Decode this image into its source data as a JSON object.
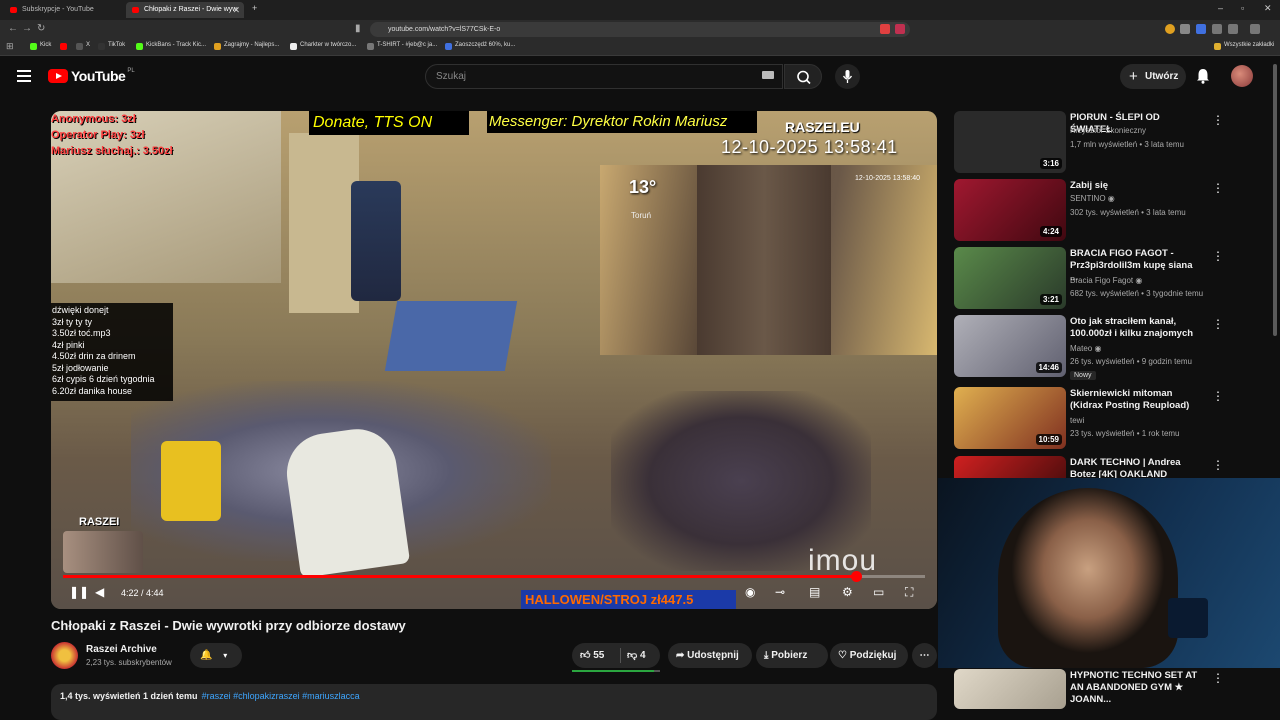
{
  "browser": {
    "tabs": [
      {
        "label": "Subskrypcje - YouTube",
        "active": false
      },
      {
        "label": "Chłopaki z Raszei - Dwie wyw",
        "active": true
      }
    ],
    "url": "youtube.com/watch?v=lS77CSk-E-o",
    "bookmarks": [
      "Kick",
      "X",
      "TikTok",
      "KickBans - Track Kic...",
      "Zagrajmy - Najleps...",
      "Charkter w twórczo...",
      "T-SHIRT - #jeb@c ja...",
      "Zaoszczędź 60%, ku..."
    ],
    "bookmarks_right": "Wszystkie zakładki"
  },
  "header": {
    "logo_text": "YouTube",
    "logo_country": "PL",
    "search_placeholder": "Szukaj",
    "create_label": "Utwórz"
  },
  "video": {
    "overlay_donations": [
      "Anonymous: 3zł",
      "Operator Play: 3zł",
      "Mariusz słuchaj.: 3.50zł"
    ],
    "donate_banner": "Donate, TTS ON",
    "messenger_banner": "Messenger: Dyrektor Rokin Mariusz",
    "site_label": "RASZEI.EU",
    "timestamp": "12-10-2025 13:58:41",
    "inset_timestamp": "12-10-2025 13:58:40",
    "temperature": "13°",
    "city": "Toruń",
    "sounds": [
      "dźwięki donejt",
      "3zł ty ty ty",
      "3.50zł toć.mp3",
      "4zł pinki",
      "4.50zł drin za drinem",
      "5zł jodłowanie",
      "6zł cypis 6 dzień tygodnia",
      "6.20zł danika house"
    ],
    "raszei_label": "RASZEI",
    "watermark": "imou",
    "halloween_banner": "HALLOWEN/STROJ  zł447.5",
    "time_display": "4:22 / 4:44",
    "progress": 0.92
  },
  "below": {
    "title": "Chłopaki z Raszei - Dwie wywrotki przy odbiorze dostawy",
    "channel_name": "Raszei Archive",
    "channel_subs": "2,23 tys. subskrybentów",
    "likes": "55",
    "dislikes": "4",
    "share_label": "Udostępnij",
    "download_label": "Pobierz",
    "thanks_label": "Podziękuj",
    "views_line": "1,4 tys. wyświetleń  1 dzień temu",
    "tags": "#raszei #chlopakizraszei #mariuszlacca",
    "like_ratio": 0.93
  },
  "recommendations": [
    {
      "title": "PIORUN - ŚLEPI OD ŚWIATEŁ",
      "channel": "Krzysztof Skonieczny",
      "meta": "1,7 mln wyświetleń • 3 lata temu",
      "duration": "3:16",
      "thumb_color": "#2a2a2a"
    },
    {
      "title": "Zabij się",
      "channel": "SENTINO",
      "meta": "302 tys. wyświetleń • 3 lata temu",
      "duration": "4:24",
      "thumb_color": "#8a1020"
    },
    {
      "title": "BRACIA FIGO FAGOT - Prz3pi3rdolil3m kupę siana ...",
      "channel": "Bracia Figo Fagot",
      "meta": "682 tys. wyświetleń • 3 tygodnie temu",
      "duration": "3:21",
      "thumb_color": "#3a6a3a"
    },
    {
      "title": "Oto jak straciłem kanał, 100.000zł i kilku znajomych",
      "channel": "Mateo",
      "meta": "26 tys. wyświetleń • 9 godzin temu",
      "duration": "14:46",
      "badge": "Nowy",
      "thumb_color": "#8a8a8a"
    },
    {
      "title": "Skierniewicki mitoman (Kidrax Posting Reupload)",
      "channel": "tewi",
      "meta": "23 tys. wyświetleń • 1 rok temu",
      "duration": "10:59",
      "thumb_color": "#c89a40"
    },
    {
      "title": "DARK TECHNO | Andrea Botez [4K] OAKLAND",
      "channel": "",
      "meta": "",
      "duration": "",
      "thumb_color": "#b01010"
    },
    {
      "title": "HYPNOTIC TECHNO SET AT AN ABANDONED GYM ★ JOANN...",
      "channel": "",
      "meta": "",
      "duration": "",
      "thumb_color": "#d0c8b8"
    }
  ]
}
